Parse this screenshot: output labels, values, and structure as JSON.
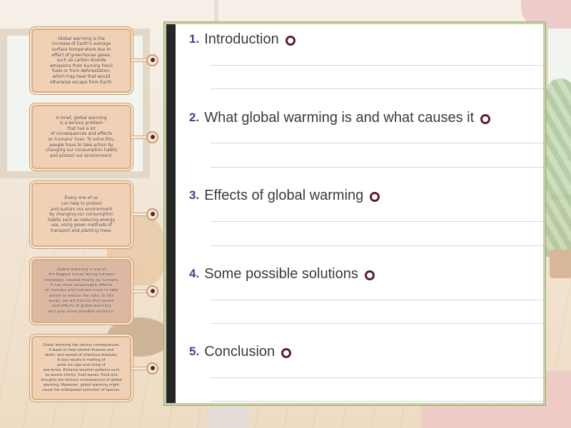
{
  "cards": [
    {
      "text": "Global warming is the\nincrease of Earth's average\nsurface temperature due to\neffect of greenhouse gases,\nsuch as carbon dioxide\nemissions from burning fossil\nfuels or from deforestation,\nwhich trap heat that would\notherwise escape from Earth."
    },
    {
      "text": "In brief, global warming\nis a serious problem\nthat has a lot\nof consequences and effects\non humans' lives. To solve this,\npeople have to take action by\nchanging our consumption habits\nand protect our environment."
    },
    {
      "text": "Every one of us\ncan help to protect\nand sustain our environment\nby changing our consumption\nhabits such as reducing energy\nuse, using green methods of\ntransport and planting trees."
    },
    {
      "text": "Global warming is one of\nthe biggest issues facing humans\nnowadays, caused mainly by humans.\nIt has most catastrophic effects\non humans and humans have to take\naction to reduce the risks. In this\nessay, we will discuss the causes\nand effects of global warming\nand give some possible solutions."
    },
    {
      "text": "Global warming has serious consequences.\nIt leads to heat-related illnesses and\ndeath, and spread of infectious diseases.\nIt also results in melting of\npolar ice caps and rising of\nsea levels. Extreme weather patterns such\nas severe storms, heat waves, flood and\ndroughts are obvious consequences of global\nwarming. Moreover, global warming might\ncause the widespread extinction of species."
    }
  ],
  "sections": [
    {
      "number": "1.",
      "label": "Introduction"
    },
    {
      "number": "2.",
      "label": "What global warming is and what causes it"
    },
    {
      "number": "3.",
      "label": "Effects of global warming"
    },
    {
      "number": "4.",
      "label": "Some possible solutions"
    },
    {
      "number": "5.",
      "label": "Conclusion"
    }
  ],
  "colors": {
    "number": "#4f3a8c",
    "target_ring": "#5a1f30",
    "card": "#f1d1b5",
    "sheet_border": "#c6cfa3"
  }
}
